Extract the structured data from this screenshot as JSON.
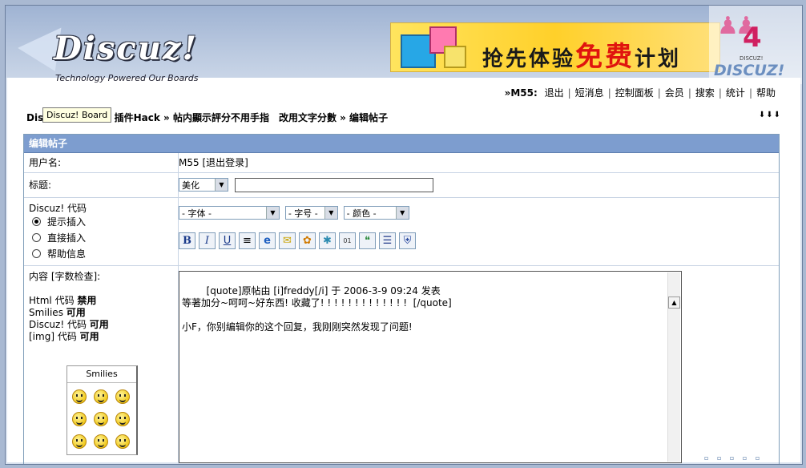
{
  "header": {
    "logo_text": "Discuz!",
    "logo_tagline": "Technology Powered Our Boards",
    "banner_part1": "抢先体验",
    "banner_part2": "免费",
    "banner_part3": "计划",
    "badge_number": "4",
    "badge_small": "DISCUZ!",
    "badge_text": "DISCUZ!"
  },
  "topnav": {
    "user": "»M55:",
    "items": [
      "退出",
      "短消息",
      "控制面板",
      "会员",
      "搜索",
      "统计",
      "帮助"
    ]
  },
  "breadcrumb": {
    "text": "Discuz! Board » 插件Hack » 帖内顯示評分不用手指　改用文字分數 » 编辑帖子",
    "tooltip": "Discuz! Board",
    "arrows": "⬇⬇⬇"
  },
  "form": {
    "title": "编辑帖子",
    "username_label": "用户名:",
    "username_value": "M55 [退出登录]",
    "subject_label": "标题:",
    "subject_select": "美化",
    "subject_value": "",
    "code_label": "Discuz! 代码",
    "modes": [
      "提示插入",
      "直接插入",
      "帮助信息"
    ],
    "mode_selected": 0,
    "font_select": "- 字体 -",
    "size_select": "- 字号 -",
    "color_select": "- 颜色 -",
    "toolbar_icons": [
      "bold-icon",
      "italic-icon",
      "underline-icon",
      "center-icon",
      "link-icon",
      "email-icon",
      "image-icon",
      "flash-icon",
      "code-icon",
      "quote-icon",
      "list-icon",
      "hide-icon"
    ],
    "toolbar_glyphs": [
      "B",
      "I",
      "U",
      "≡",
      "e",
      "✉",
      "✿",
      "✱",
      "01",
      "❝",
      "☰",
      "⛨"
    ],
    "content_label": "内容 [字数检查]:",
    "html_label": "Html 代码",
    "html_status": "禁用",
    "smilies_label": "Smilies",
    "smilies_status": "可用",
    "discuz_label": "Discuz! 代码",
    "discuz_status": "可用",
    "img_label": "[img] 代码",
    "img_status": "可用",
    "smilies_title": "Smilies",
    "content_value": "[quote]原帖由 [i]freddy[/i] 于 2006-3-9 09:24 发表\n等著加分~呵呵~好东西! 收藏了! ! ! ! ! ! ! ! ! ! ! ! !  [/quote]\n\n小F，你别编辑你的这个回复，我刚刚突然发现了问题!"
  }
}
